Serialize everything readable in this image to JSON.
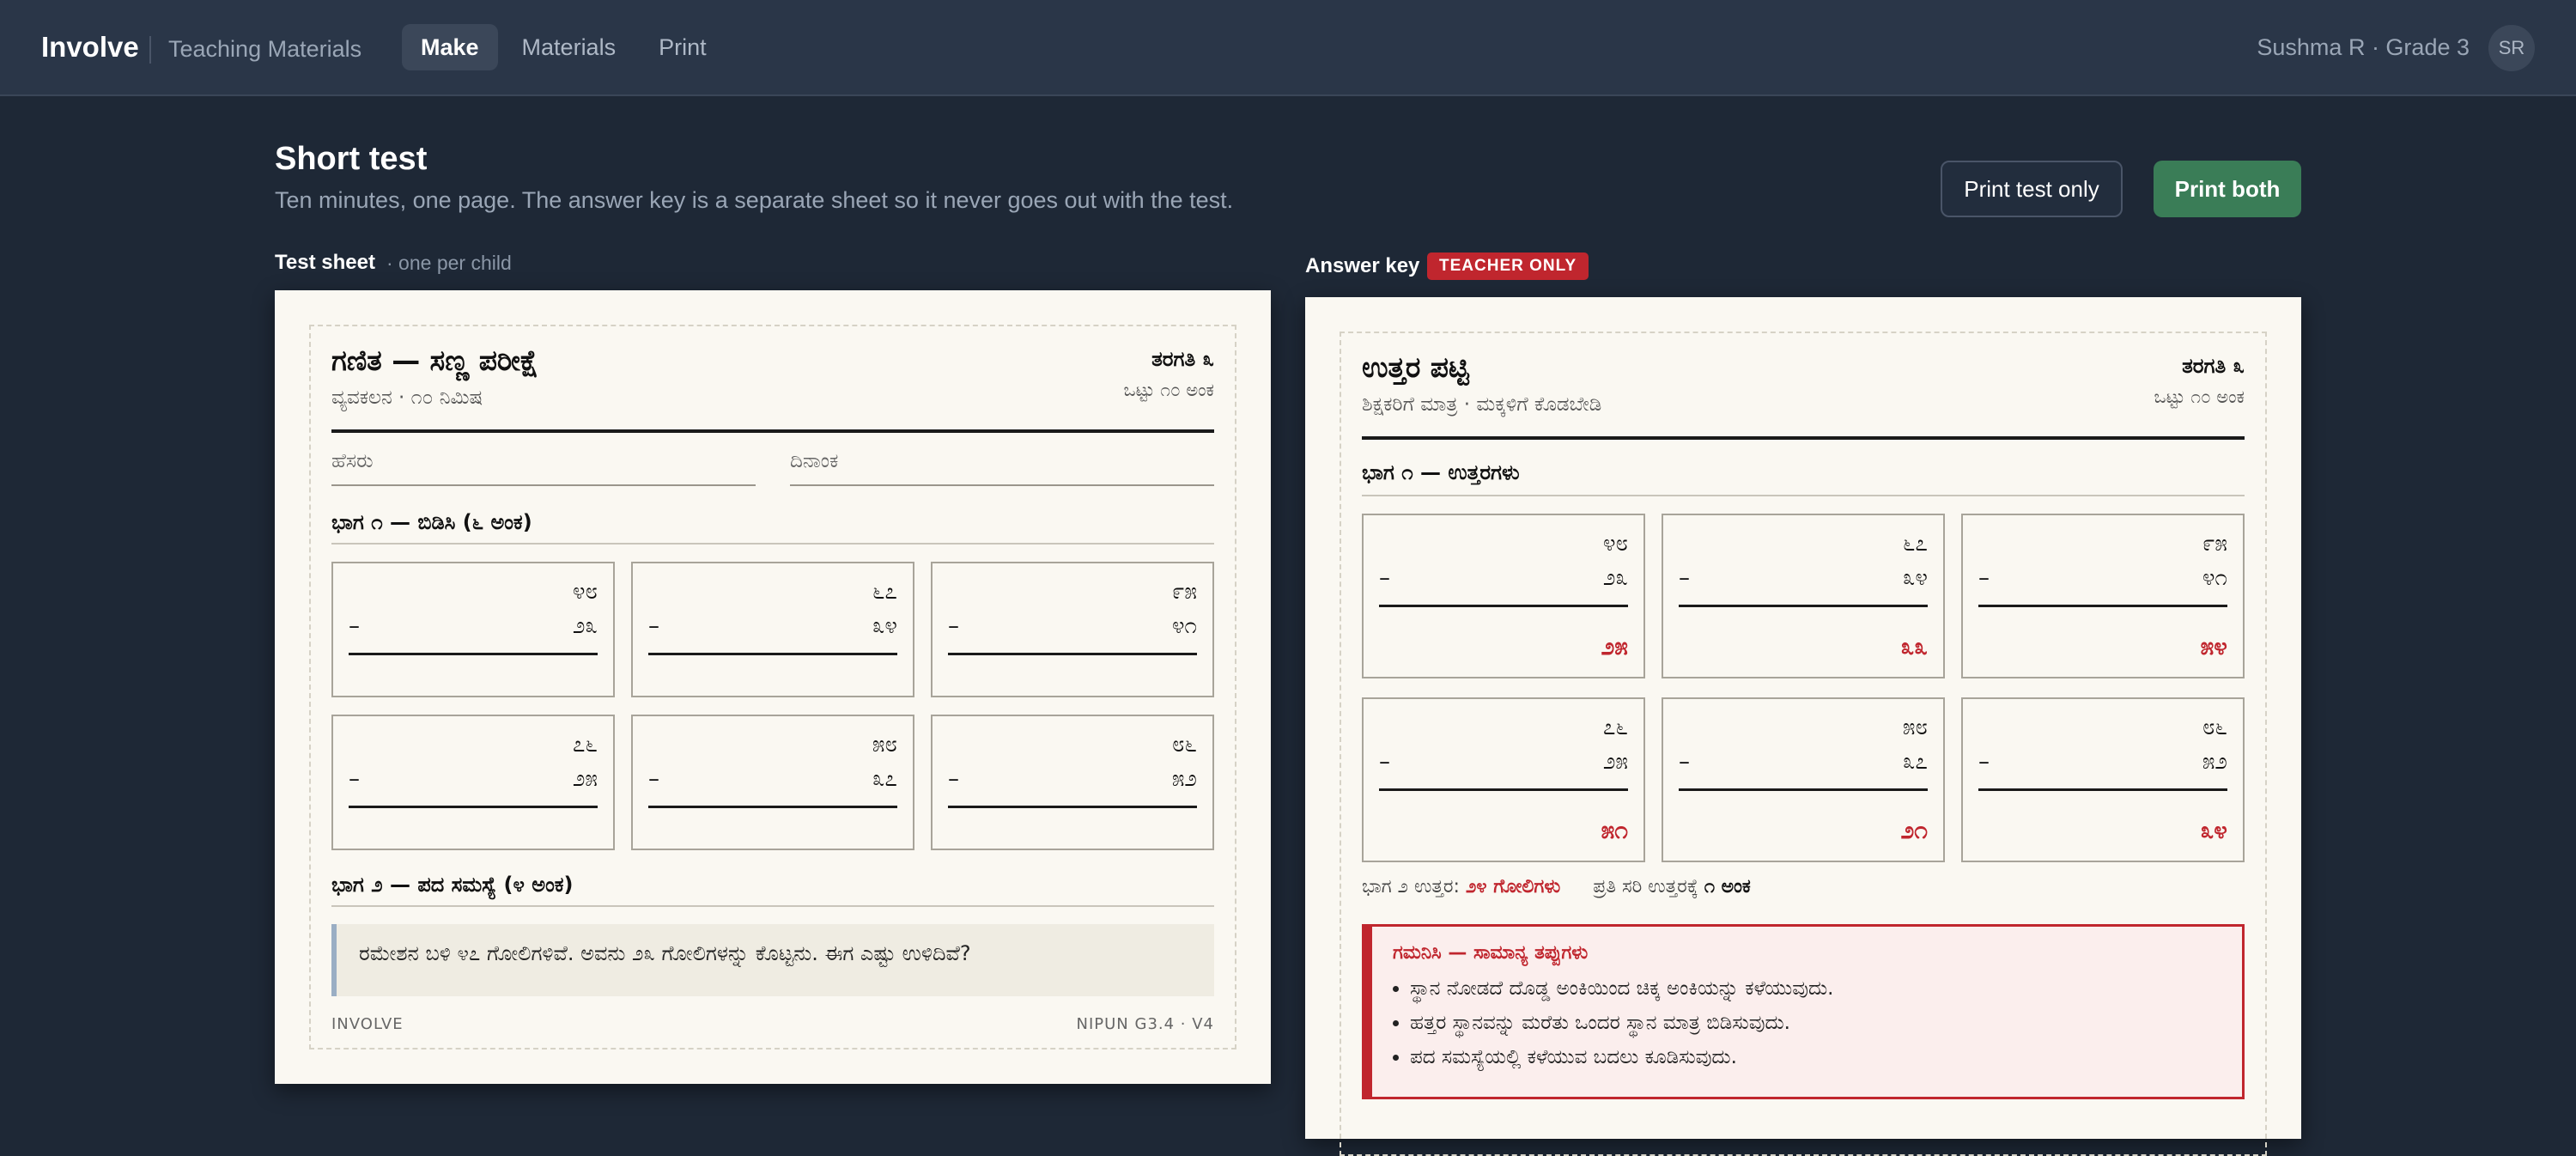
{
  "topbar": {
    "brand": "Involve",
    "subtitle": "Teaching Materials",
    "nav": [
      "Make",
      "Materials",
      "Print"
    ],
    "user": "Sushma R · Grade 3",
    "avatar": "SR"
  },
  "header": {
    "title": "Short test",
    "subtitle": "Ten minutes, one page. The answer key is a separate sheet so it never goes out with the test.",
    "print_test_only": "Print test only",
    "print_both": "Print both"
  },
  "test_section": {
    "label": "Test sheet",
    "note": "· one per child"
  },
  "key_section": {
    "label": "Answer key",
    "badge": "TEACHER ONLY"
  },
  "test_sheet": {
    "title": "ಗಣಿತ — ಸಣ್ಣ ಪರೀಕ್ಷೆ",
    "subtitle": "ವ್ಯವಕಲನ · ೧೦ ನಿಮಿಷ",
    "grade": "ತರಗತಿ ೩",
    "marks": "ಒಟ್ಟು ೧೦ ಅಂಕ",
    "name_label": "ಹೆಸರು",
    "date_label": "ದಿನಾಂಕ",
    "part1": "ಭಾಗ ೧ — ಬಿಡಿಸಿ (೬ ಅಂಕ)",
    "part2": "ಭಾಗ ೨ — ಪದ ಸಮಸ್ಯೆ (೪ ಅಂಕ)",
    "word_problem": "ರಮೇಶನ ಬಳಿ ೪೭ ಗೋಲಿಗಳಿವೆ. ಅವನು ೨೩ ಗೋಲಿಗಳನ್ನು ಕೊಟ್ಟನು. ಈಗ ಎಷ್ಟು ಉಳಿದಿವೆ?",
    "footer_left": "INVOLVE",
    "footer_right": "NIPUN G3.4 · V4"
  },
  "problems": [
    {
      "top": "೪೮",
      "minus": "–",
      "bottom": "೨೩",
      "answer": "೨೫"
    },
    {
      "top": "೬೭",
      "minus": "–",
      "bottom": "೩೪",
      "answer": "೩೩"
    },
    {
      "top": "೯೫",
      "minus": "–",
      "bottom": "೪೧",
      "answer": "೫೪"
    },
    {
      "top": "೭೬",
      "minus": "–",
      "bottom": "೨೫",
      "answer": "೫೧"
    },
    {
      "top": "೫೮",
      "minus": "–",
      "bottom": "೩೭",
      "answer": "೨೧"
    },
    {
      "top": "೮೬",
      "minus": "–",
      "bottom": "೫೨",
      "answer": "೩೪"
    }
  ],
  "answer_key": {
    "title": "ಉತ್ತರ ಪಟ್ಟಿ",
    "subtitle": "ಶಿಕ್ಷಕರಿಗೆ ಮಾತ್ರ · ಮಕ್ಕಳಿಗೆ ಕೊಡಬೇಡಿ",
    "grade": "ತರಗತಿ ೩",
    "marks": "ಒಟ್ಟು ೧೦ ಅಂಕ",
    "part1": "ಭಾಗ ೧ — ಉತ್ತರಗಳು",
    "part2_prefix": "ಭಾಗ ೨ ಉತ್ತರ:",
    "part2_answer": "೨೪ ಗೋಲಿಗಳು",
    "per_answer_prefix": "ಪ್ರತಿ ಸರಿ ಉತ್ತರಕ್ಕೆ",
    "per_answer_marks": "೧ ಅಂಕ",
    "mistakes_title": "ಗಮನಿಸಿ — ಸಾಮಾನ್ಯ ತಪ್ಪುಗಳು",
    "mistakes": [
      "ಸ್ಥಾನ ನೋಡದೆ ದೊಡ್ಡ ಅಂಕಿಯಿಂದ ಚಿಕ್ಕ ಅಂಕಿಯನ್ನು ಕಳೆಯುವುದು.",
      "ಹತ್ತರ ಸ್ಥಾನವನ್ನು ಮರೆತು ಒಂದರ ಸ್ಥಾನ ಮಾತ್ರ ಬಿಡಿಸುವುದು.",
      "ಪದ ಸಮಸ್ಯೆಯಲ್ಲಿ ಕಳೆಯುವ ಬದಲು ಕೂಡಿಸುವುದು."
    ]
  }
}
